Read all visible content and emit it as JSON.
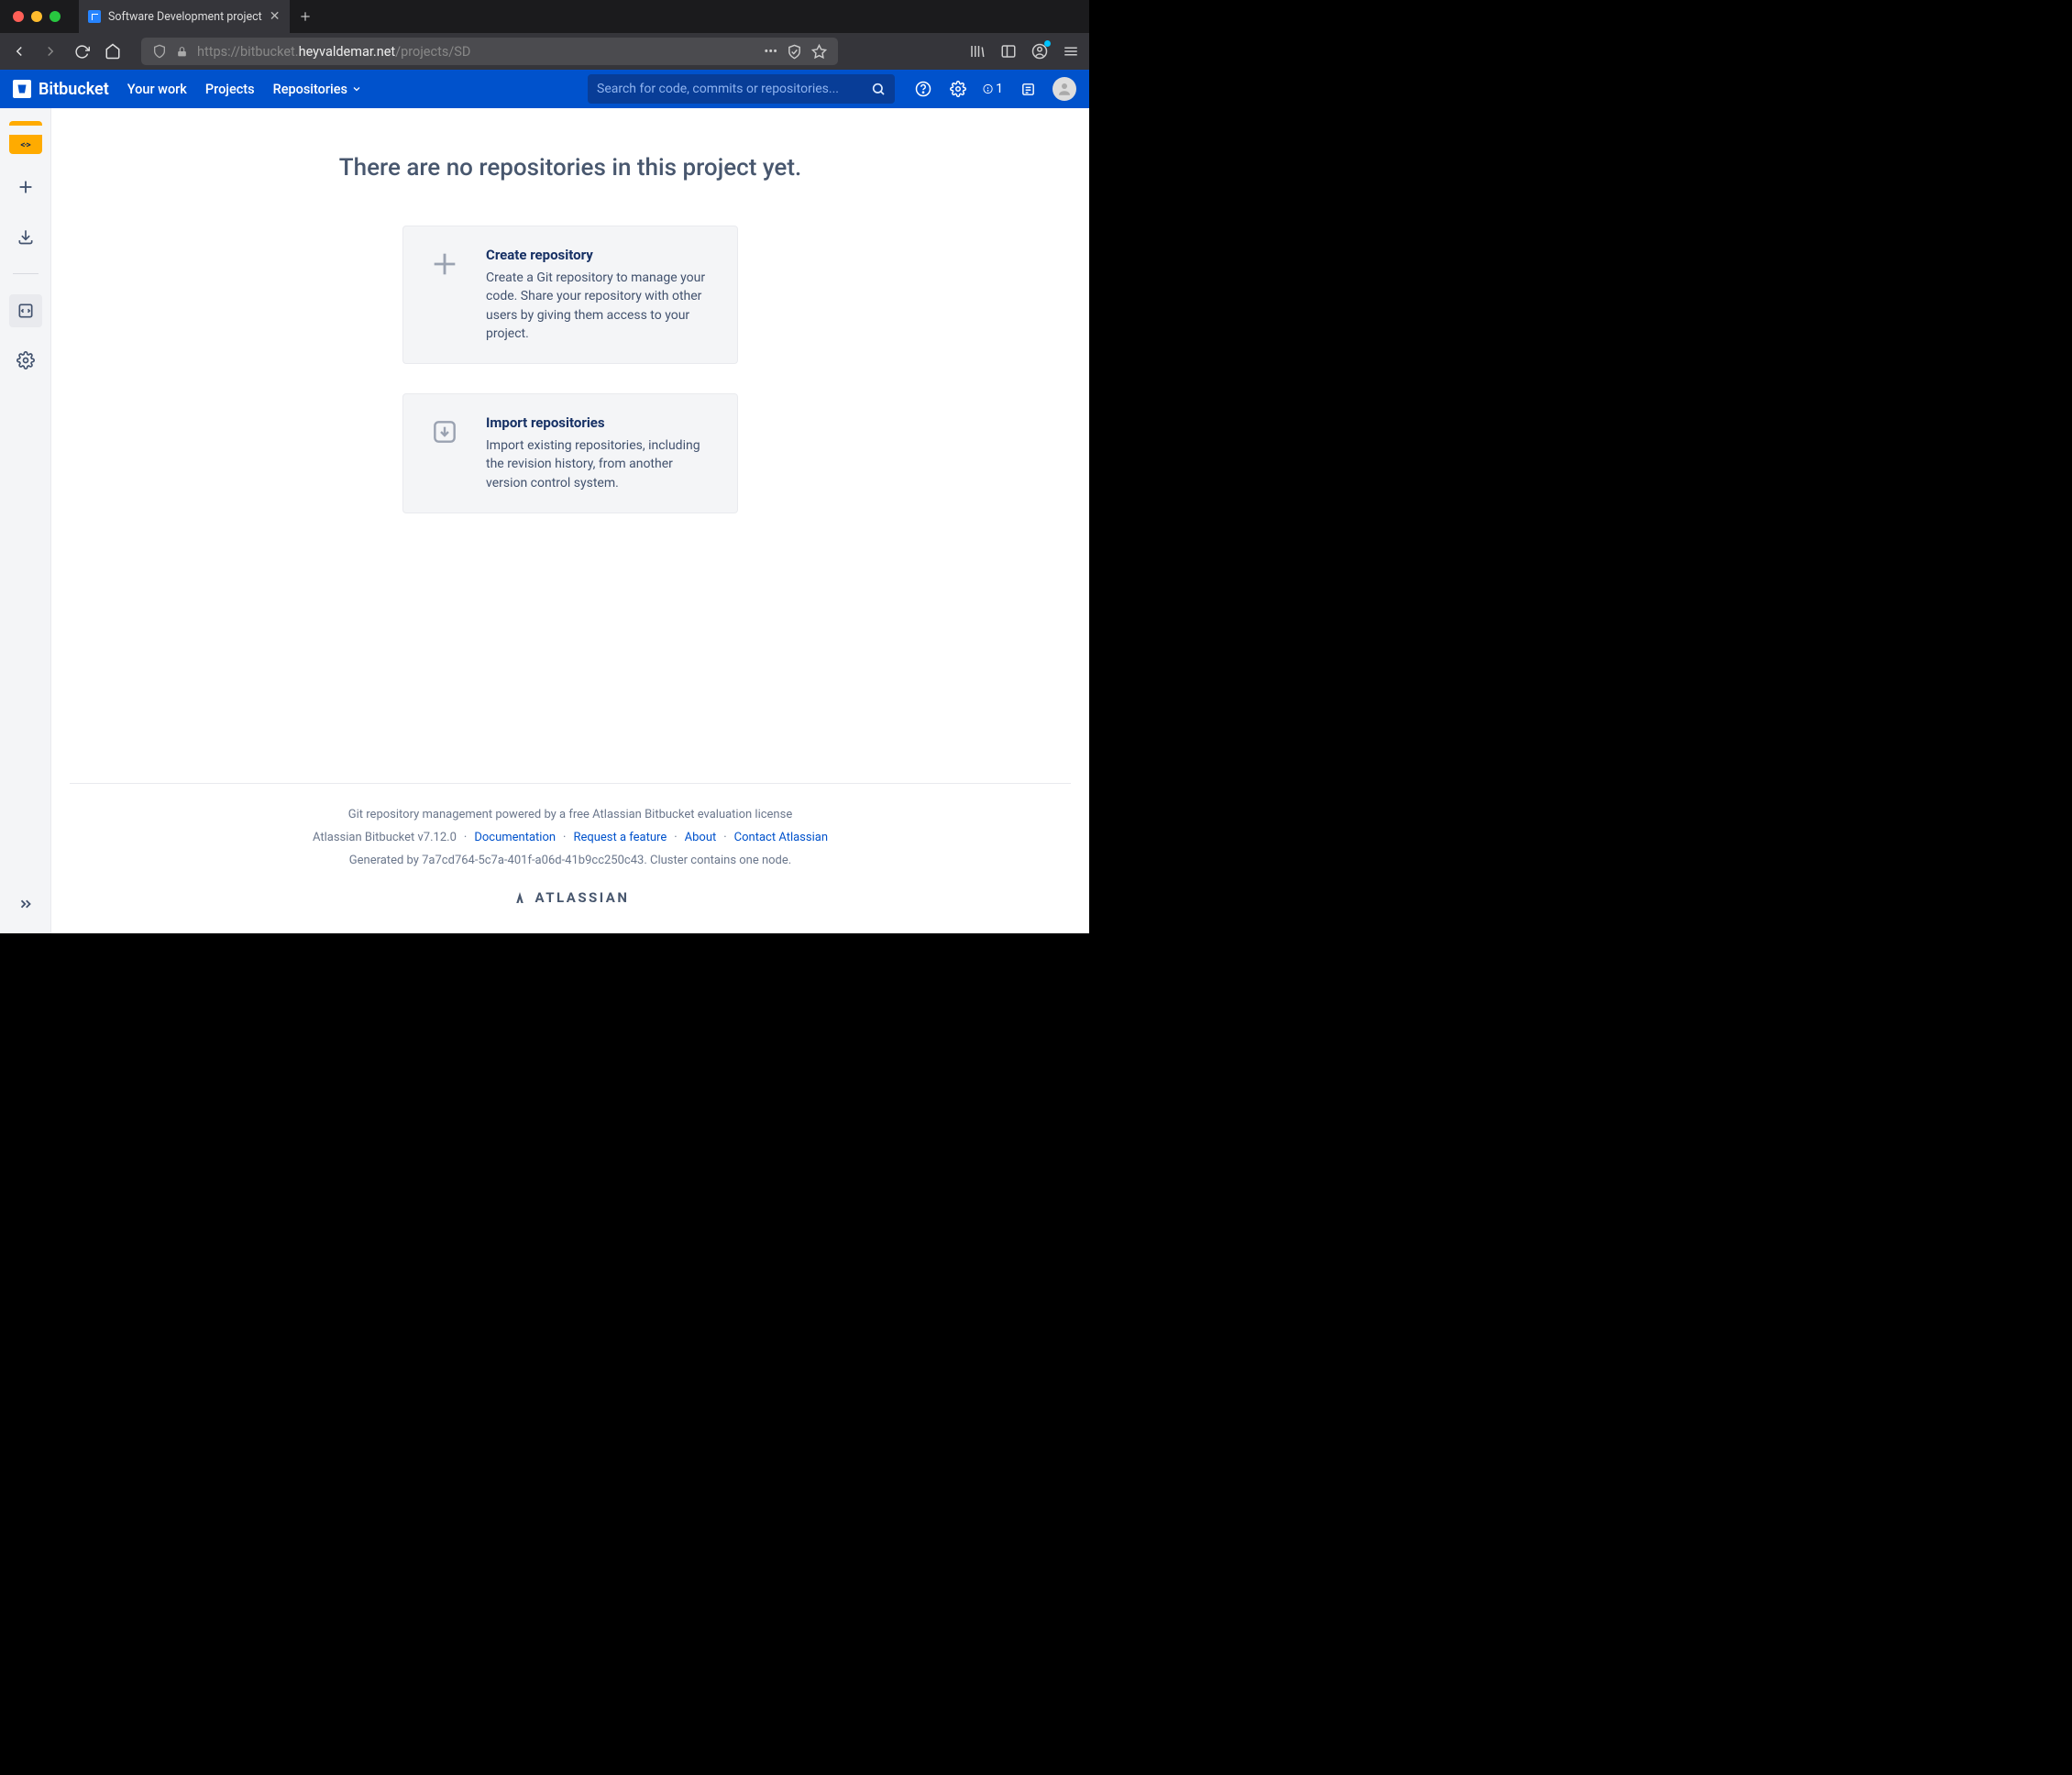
{
  "browser": {
    "tab_title": "Software Development project",
    "url_prefix": "https://bitbucket.",
    "url_host": "heyvaldemar.net",
    "url_path": "/projects/SD"
  },
  "header": {
    "product": "Bitbucket",
    "nav": {
      "your_work": "Your work",
      "projects": "Projects",
      "repositories": "Repositories"
    },
    "search_placeholder": "Search for code, commits or repositories...",
    "notif_count": "1"
  },
  "content": {
    "title": "There are no repositories in this project yet.",
    "cards": {
      "create": {
        "title": "Create repository",
        "desc": "Create a Git repository to manage your code. Share your repository with other users by giving them access to your project."
      },
      "import": {
        "title": "Import repositories",
        "desc": "Import existing repositories, including the revision history, from another version control system."
      }
    }
  },
  "footer": {
    "license": "Git repository management powered by a free Atlassian Bitbucket evaluation license",
    "version": "Atlassian Bitbucket v7.12.0",
    "links": {
      "docs": "Documentation",
      "feature": "Request a feature",
      "about": "About",
      "contact": "Contact Atlassian"
    },
    "generated": "Generated by 7a7cd764-5c7a-401f-a06d-41b9cc250c43. Cluster contains one node.",
    "brand": "ATLASSIAN"
  }
}
